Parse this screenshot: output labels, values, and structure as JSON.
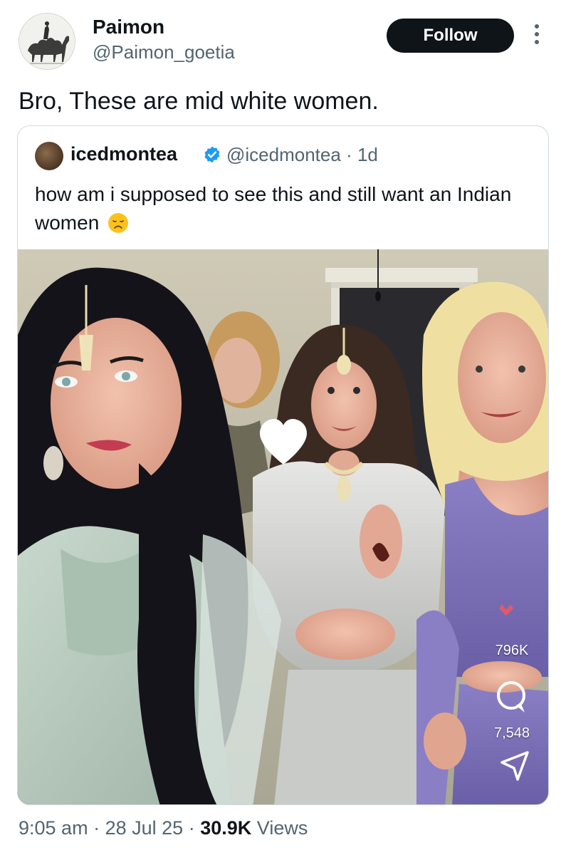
{
  "author": {
    "name": "Paimon",
    "handle": "@Paimon_goetia",
    "avatar_icon": "engraving-camel-avatar"
  },
  "actions": {
    "follow_label": "Follow",
    "more_icon": "more-vertical-icon"
  },
  "tweet": {
    "text": "Bro, These are mid white women."
  },
  "quoted": {
    "name": "icedmontea",
    "verified": true,
    "handle": "@icedmontea",
    "separator": "·",
    "age": "1d",
    "text": "how am i supposed to see this and still want an Indian women",
    "emoji": "disappointed-face",
    "media": {
      "type": "video-still",
      "like_count": "796K",
      "comment_count": "7,548",
      "icons": [
        "heart-icon",
        "comment-icon",
        "share-icon"
      ]
    }
  },
  "footer": {
    "time": "9:05 am",
    "dot1": "·",
    "date": "28 Jul 25",
    "dot2": "·",
    "views_count": "30.9K",
    "views_label": "Views"
  },
  "colors": {
    "text_primary": "#0f1419",
    "text_secondary": "#536471",
    "border": "#cfd9de",
    "follow_bg": "#0f1419",
    "verified_blue": "#1d9bf0",
    "lehenga_purple": "#7a6fb4"
  }
}
